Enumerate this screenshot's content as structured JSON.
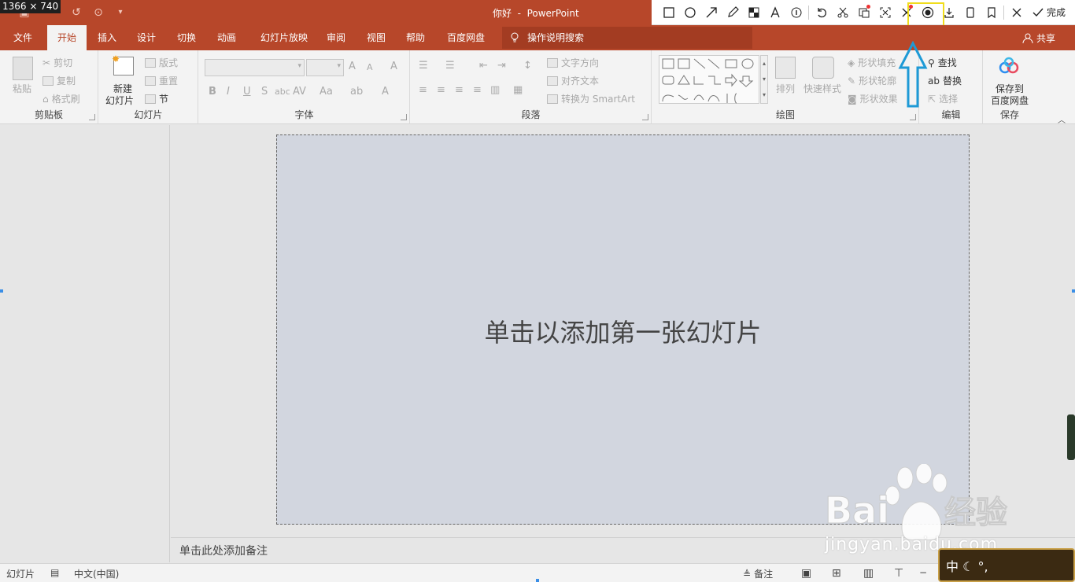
{
  "window": {
    "dimensions_label": "1366 × 740",
    "title": "你好  -  PowerPoint"
  },
  "snip_toolbar": {
    "tools": [
      "rectangle-icon",
      "ellipse-icon",
      "arrow-icon",
      "pen-icon",
      "mosaic-icon",
      "text-icon",
      "number-icon",
      "undo-icon",
      "crop-icon",
      "pin-icon",
      "screen-capture-icon",
      "x-mark-icon",
      "record-icon",
      "download-icon",
      "save-icon",
      "bookmark-icon",
      "close-icon"
    ],
    "done_label": "完成"
  },
  "tabs": [
    "文件",
    "开始",
    "插入",
    "设计",
    "切换",
    "动画",
    "幻灯片放映",
    "审阅",
    "视图",
    "帮助",
    "百度网盘"
  ],
  "tell_me": "操作说明搜索",
  "share": "共享",
  "ribbon": {
    "clipboard": {
      "label": "剪贴板",
      "paste": "粘贴",
      "cut": "剪切",
      "copy": "复制",
      "format_painter": "格式刷"
    },
    "slides": {
      "label": "幻灯片",
      "new_slide_1": "新建",
      "new_slide_2": "幻灯片",
      "layout": "版式",
      "reset": "重置",
      "section": "节"
    },
    "font": {
      "label": "字体",
      "bold": "B",
      "italic": "I",
      "underline": "U",
      "strike": "S",
      "shadow": "abc",
      "spacing": "AV",
      "case": "Aa",
      "color": "A",
      "grow": "A",
      "shrink": "A",
      "clear": "A"
    },
    "paragraph": {
      "label": "段落",
      "text_direction": "文字方向",
      "align_text": "对齐文本",
      "smartart": "转换为 SmartArt"
    },
    "drawing": {
      "label": "绘图",
      "arrange": "排列",
      "quick_styles": "快速样式",
      "shape_fill": "形状填充",
      "shape_outline": "形状轮廓",
      "shape_effects": "形状效果"
    },
    "editing": {
      "label": "编辑",
      "find": "查找",
      "replace": "替换",
      "select": "选择"
    },
    "save": {
      "label": "保存",
      "save_to_1": "保存到",
      "save_to_2": "百度网盘"
    }
  },
  "slide": {
    "placeholder": "单击以添加第一张幻灯片"
  },
  "notes": {
    "placeholder": "单击此处添加备注"
  },
  "status": {
    "slide": "幻灯片",
    "language": "中文(中国)",
    "notes": "备注"
  },
  "watermark": {
    "text": "jingyan.baidu.com",
    "badge": "中 ☾ °,"
  },
  "colors": {
    "accent": "#b7472a",
    "highlight": "#f0dd1c",
    "arrow": "#1e9ad6"
  }
}
